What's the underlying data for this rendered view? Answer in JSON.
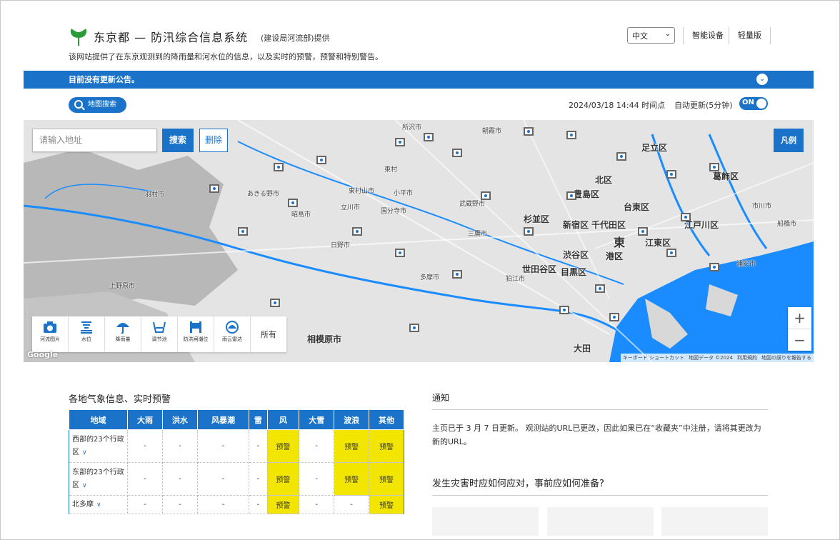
{
  "header": {
    "site_title": "东京都 — 防汛综合信息系统",
    "provider": "(建设局河流部)提供",
    "intro": "该网站提供了在东京观测到的降雨量和河水位的信息，以及实时的预警，预警和特别警告。",
    "language": "中文",
    "links": [
      "智能设备",
      "轻量版"
    ]
  },
  "announcement": {
    "text": "目前没有更新公告。"
  },
  "toolbar": {
    "map_search": "地图搜索",
    "timestamp": "2024/03/18 14:44 时间点",
    "auto_update_label": "自动更新(5分钟)",
    "auto_update_state": "ON"
  },
  "map": {
    "address_placeholder": "请输入地址",
    "search_button": "搜索",
    "delete_button": "删除",
    "legend_button": "凡例",
    "layers": [
      {
        "label": "河流图片",
        "icon": "camera-icon"
      },
      {
        "label": "水位",
        "icon": "water-level-icon"
      },
      {
        "label": "降雨量",
        "icon": "rain-umbrella-icon"
      },
      {
        "label": "调节池",
        "icon": "reservoir-icon"
      },
      {
        "label": "防洪闸潮位",
        "icon": "floodgate-icon"
      },
      {
        "label": "雨云雷达",
        "icon": "radar-icon"
      }
    ],
    "all_layers": "所有",
    "zoom_in": "+",
    "zoom_out": "−",
    "brand": "Google",
    "attribution": [
      "キーボード ショートカット",
      "地図データ ©2024",
      "利用規約",
      "地図の誤りを報告する"
    ],
    "places": [
      "所沢市",
      "東村",
      "朝霞市",
      "足立区",
      "東村山市",
      "北区",
      "葛飾区",
      "あきる野市",
      "立川市",
      "小平市",
      "武蔵野市",
      "豊島区",
      "台東区",
      "船橋市",
      "羽村市",
      "昭島市",
      "国分寺市",
      "杉並区",
      "江戸川区",
      "市川市",
      "新宿区",
      "千代田区",
      "東",
      "日野市",
      "港区",
      "江東区",
      "三鷹市",
      "渋谷区",
      "世田谷区",
      "目黒区",
      "浦安市",
      "上野原市",
      "多摩市",
      "狛江市",
      "相模原市",
      "大田"
    ],
    "colors": {
      "water": "#1a8cff",
      "land": "#e4e4e4",
      "bay": "#1a8cff",
      "marker": "#555555"
    }
  },
  "weather": {
    "title": "各地气象信息、实时预警",
    "columns": [
      "地域",
      "大雨",
      "洪水",
      "风暴潮",
      "雷",
      "风",
      "大雪",
      "波浪",
      "其他"
    ],
    "rows": [
      {
        "region": "西部的23个行政区",
        "cells": [
          "-",
          "-",
          "-",
          "-",
          "预警",
          "-",
          "预警",
          "预警"
        ]
      },
      {
        "region": "东部的23个行政区",
        "cells": [
          "-",
          "-",
          "-",
          "-",
          "预警",
          "-",
          "预警",
          "预警"
        ]
      },
      {
        "region": "北多摩",
        "cells": [
          "-",
          "-",
          "-",
          "-",
          "预警",
          "-",
          "-",
          "预警"
        ]
      }
    ],
    "warn_color": "#f2e600"
  },
  "notice": {
    "title": "通知",
    "body": "主页已于 3 月 7 日更新。 观测站的URL已更改，因此如果已在“收藏夹”中注册，请将其更改为新的URL。",
    "question": "发生灾害时应如何应对，事前应如何准备?"
  }
}
